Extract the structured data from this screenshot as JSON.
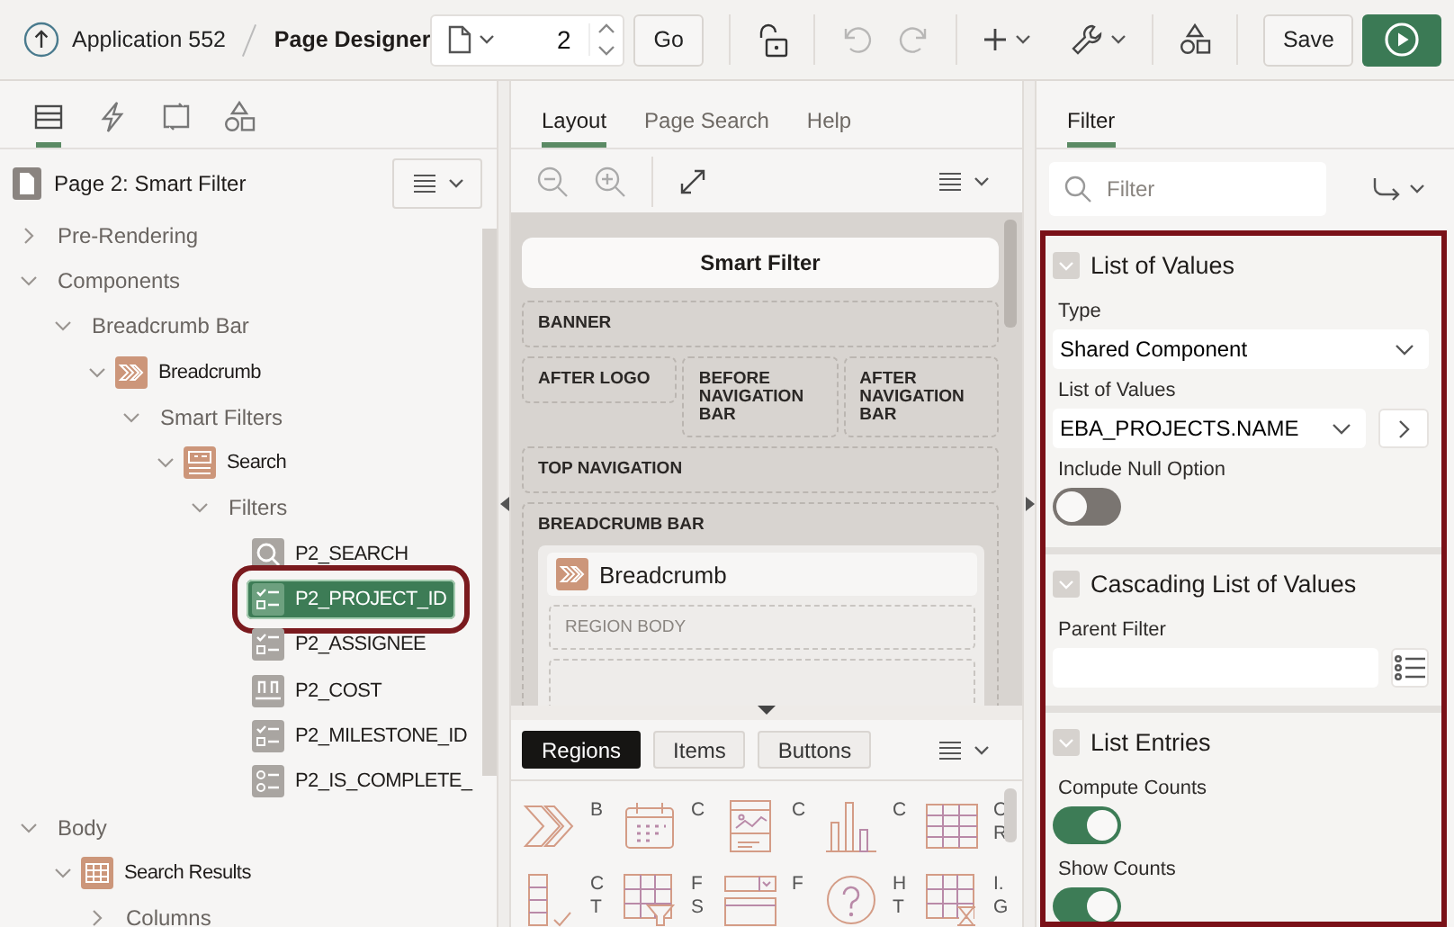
{
  "header": {
    "app_link": "Application 552",
    "page_title": "Page Designer",
    "page_number": "2",
    "go_button": "Go",
    "undo": {
      "disabled": true
    },
    "redo": {
      "disabled": true
    },
    "save_button": "Save"
  },
  "left_panel": {
    "tabs": [
      {
        "kind": "rendering",
        "selected": true
      },
      {
        "kind": "dynamic-actions",
        "selected": false
      },
      {
        "kind": "processing",
        "selected": false
      },
      {
        "kind": "shared-components",
        "selected": false
      }
    ],
    "tree": {
      "title": "Page 2: Smart Filter",
      "nodes": [
        {
          "label": "Pre-Rendering",
          "expanded": false,
          "selected": false
        },
        {
          "label": "Components",
          "expanded": true,
          "selected": false,
          "children": [
            {
              "label": "Breadcrumb Bar",
              "expanded": true,
              "selected": false,
              "children": [
                {
                  "label": "Breadcrumb",
                  "kind": "breadcrumb",
                  "expanded": true,
                  "selected": false,
                  "children": [
                    {
                      "label": "Smart Filters",
                      "expanded": true,
                      "selected": false,
                      "children": [
                        {
                          "label": "Search",
                          "kind": "search-region",
                          "expanded": true,
                          "selected": false,
                          "children": [
                            {
                              "label": "Filters",
                              "expanded": true,
                              "selected": false,
                              "children": [
                                {
                                  "label": "P2_SEARCH",
                                  "kind": "search-item",
                                  "selected": false
                                },
                                {
                                  "label": "P2_PROJECT_ID",
                                  "kind": "checkbox-list",
                                  "selected": true
                                },
                                {
                                  "label": "P2_ASSIGNEE",
                                  "kind": "checkbox-list",
                                  "selected": false
                                },
                                {
                                  "label": "P2_COST",
                                  "kind": "range",
                                  "selected": false
                                },
                                {
                                  "label": "P2_MILESTONE_ID",
                                  "kind": "checkbox-list",
                                  "selected": false
                                },
                                {
                                  "label": "P2_IS_COMPLETE_",
                                  "kind": "radio-group",
                                  "selected": false
                                }
                              ]
                            }
                          ]
                        }
                      ]
                    }
                  ]
                }
              ]
            }
          ]
        },
        {
          "label": "Body",
          "expanded": true,
          "selected": false,
          "children": [
            {
              "label": "Search Results",
              "kind": "report",
              "expanded": true,
              "selected": false,
              "children": [
                {
                  "label": "Columns",
                  "expanded": false,
                  "selected": false
                }
              ]
            }
          ]
        }
      ]
    }
  },
  "middle_panel": {
    "tabs": [
      {
        "label": "Layout",
        "selected": true
      },
      {
        "label": "Page Search",
        "selected": false
      },
      {
        "label": "Help",
        "selected": false
      }
    ],
    "canvas": {
      "page_title": "Smart Filter",
      "rows": [
        [
          {
            "label": "BANNER"
          }
        ],
        [
          {
            "label": "AFTER LOGO"
          },
          {
            "label": "BEFORE NAVIGATION BAR"
          },
          {
            "label": "AFTER NAVIGATION BAR"
          }
        ],
        [
          {
            "label": "TOP NAVIGATION"
          }
        ],
        [
          {
            "label": "BREADCRUMB BAR",
            "regions": [
              {
                "title": "Breadcrumb",
                "kind": "breadcrumb",
                "body": "REGION BODY"
              }
            ]
          }
        ]
      ]
    },
    "gallery": {
      "tabs": [
        {
          "label": "Regions",
          "selected": true
        },
        {
          "label": "Items",
          "selected": false
        },
        {
          "label": "Buttons",
          "selected": false
        }
      ],
      "items": [
        {
          "kind": "chevrons",
          "label": "B"
        },
        {
          "kind": "calendar",
          "label": "C"
        },
        {
          "kind": "card",
          "label": "C"
        },
        {
          "kind": "chart",
          "label": "C"
        },
        {
          "kind": "table",
          "label": "C R"
        },
        {
          "kind": "column-toggle",
          "label": "C T"
        },
        {
          "kind": "faceted",
          "label": "F S"
        },
        {
          "kind": "form",
          "label": "F"
        },
        {
          "kind": "help",
          "label": "H T"
        },
        {
          "kind": "grid",
          "label": "I. G"
        }
      ]
    }
  },
  "right_panel": {
    "tabs": [
      {
        "label": "Filter",
        "selected": true
      }
    ],
    "filter": {
      "placeholder": "Filter"
    },
    "framed": true,
    "sections": [
      {
        "title": "List of Values",
        "expanded": true,
        "properties": [
          {
            "kind": "select",
            "label": "Type",
            "value": "Shared Component"
          },
          {
            "kind": "select-link",
            "label": "List of Values",
            "value": "EBA_PROJECTS.NAME"
          },
          {
            "kind": "switch",
            "label": "Include Null Option",
            "on": false
          }
        ]
      },
      {
        "title": "Cascading List of Values",
        "expanded": true,
        "properties": [
          {
            "kind": "picker",
            "label": "Parent Filter"
          }
        ]
      },
      {
        "title": "List Entries",
        "expanded": true,
        "properties": [
          {
            "kind": "switch",
            "label": "Compute Counts",
            "on": true
          },
          {
            "kind": "switch",
            "label": "Show Counts",
            "on": true
          }
        ]
      }
    ]
  }
}
